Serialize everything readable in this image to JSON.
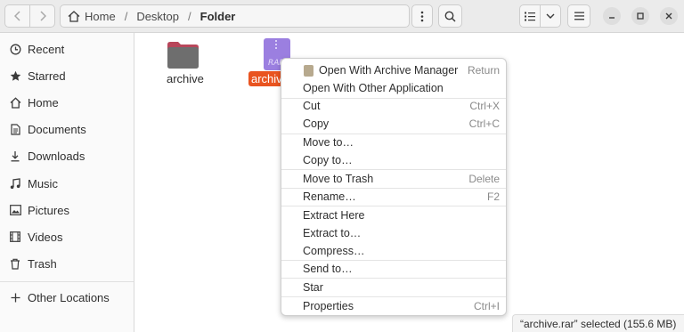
{
  "pathbar": {
    "home_label": "Home",
    "crumb_desktop": "Desktop",
    "crumb_current": "Folder"
  },
  "sidebar": {
    "items": [
      {
        "label": "Recent",
        "icon": "clock-icon"
      },
      {
        "label": "Starred",
        "icon": "star-icon"
      },
      {
        "label": "Home",
        "icon": "home-icon"
      },
      {
        "label": "Documents",
        "icon": "document-icon"
      },
      {
        "label": "Downloads",
        "icon": "download-icon"
      },
      {
        "label": "Music",
        "icon": "music-icon"
      },
      {
        "label": "Pictures",
        "icon": "picture-icon"
      },
      {
        "label": "Videos",
        "icon": "video-icon"
      },
      {
        "label": "Trash",
        "icon": "trash-icon"
      },
      {
        "label": "Other Locations",
        "icon": "plus-icon"
      }
    ]
  },
  "files": {
    "folder_name": "archive",
    "rar_selected_label": "archive.rar",
    "rar_icon_text": "RAR"
  },
  "context_menu": {
    "items": [
      {
        "label": "Open With Archive Manager",
        "accel": "Return"
      },
      {
        "label": "Open With Other Application",
        "accel": ""
      },
      {
        "label": "Cut",
        "accel": "Ctrl+X"
      },
      {
        "label": "Copy",
        "accel": "Ctrl+C"
      },
      {
        "label": "Move to…",
        "accel": ""
      },
      {
        "label": "Copy to…",
        "accel": ""
      },
      {
        "label": "Move to Trash",
        "accel": "Delete"
      },
      {
        "label": "Rename…",
        "accel": "F2"
      },
      {
        "label": "Extract Here",
        "accel": ""
      },
      {
        "label": "Extract to…",
        "accel": ""
      },
      {
        "label": "Compress…",
        "accel": ""
      },
      {
        "label": "Send to…",
        "accel": ""
      },
      {
        "label": "Star",
        "accel": ""
      },
      {
        "label": "Properties",
        "accel": "Ctrl+I"
      }
    ]
  },
  "statusbar": {
    "text": "“archive.rar” selected  (155.6 MB)"
  },
  "colors": {
    "accent": "#e95420",
    "folder": "#6e6e6e",
    "rar_icon": "#9b7fe0"
  }
}
